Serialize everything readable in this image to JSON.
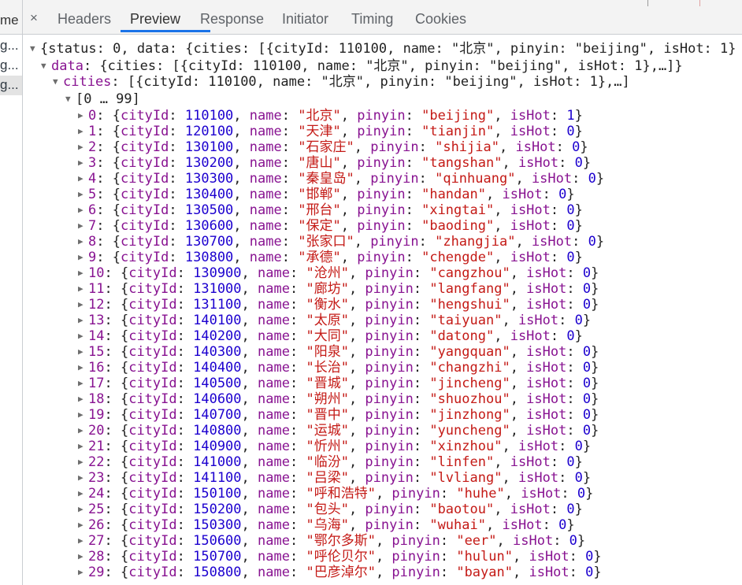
{
  "sidebar": {
    "header": "me",
    "rows": [
      "g...",
      "g...",
      "g..."
    ]
  },
  "tabs": {
    "close": "×",
    "items": [
      {
        "label": "Headers",
        "active": false
      },
      {
        "label": "Preview",
        "active": true
      },
      {
        "label": "Response",
        "active": false
      },
      {
        "label": "Initiator",
        "active": false
      },
      {
        "label": "Timing",
        "active": false
      },
      {
        "label": "Cookies",
        "active": false
      }
    ]
  },
  "preview": {
    "root_summary": "{status: 0, data: {cities: [{cityId: 110100, name: \"北京\", pinyin: \"beijing\", isHot: 1}",
    "data_summary": "{cities: [{cityId: 110100, name: \"北京\", pinyin: \"beijing\", isHot: 1},…]}",
    "cities_summary": "[{cityId: 110100, name: \"北京\", pinyin: \"beijing\", isHot: 1},…]",
    "range_label": "[0 … 99]",
    "keys": {
      "data": "data",
      "cities": "cities"
    },
    "field_names": {
      "id": "cityId",
      "name": "name",
      "pinyin": "pinyin",
      "hot": "isHot"
    },
    "cities": [
      {
        "index": "0",
        "cityId": "110100",
        "name": "\"北京\"",
        "pinyin": "\"beijing\"",
        "isHot": "1"
      },
      {
        "index": "1",
        "cityId": "120100",
        "name": "\"天津\"",
        "pinyin": "\"tianjin\"",
        "isHot": "0"
      },
      {
        "index": "2",
        "cityId": "130100",
        "name": "\"石家庄\"",
        "pinyin": "\"shijia\"",
        "isHot": "0"
      },
      {
        "index": "3",
        "cityId": "130200",
        "name": "\"唐山\"",
        "pinyin": "\"tangshan\"",
        "isHot": "0"
      },
      {
        "index": "4",
        "cityId": "130300",
        "name": "\"秦皇岛\"",
        "pinyin": "\"qinhuang\"",
        "isHot": "0"
      },
      {
        "index": "5",
        "cityId": "130400",
        "name": "\"邯郸\"",
        "pinyin": "\"handan\"",
        "isHot": "0"
      },
      {
        "index": "6",
        "cityId": "130500",
        "name": "\"邢台\"",
        "pinyin": "\"xingtai\"",
        "isHot": "0"
      },
      {
        "index": "7",
        "cityId": "130600",
        "name": "\"保定\"",
        "pinyin": "\"baoding\"",
        "isHot": "0"
      },
      {
        "index": "8",
        "cityId": "130700",
        "name": "\"张家口\"",
        "pinyin": "\"zhangjia\"",
        "isHot": "0"
      },
      {
        "index": "9",
        "cityId": "130800",
        "name": "\"承德\"",
        "pinyin": "\"chengde\"",
        "isHot": "0"
      },
      {
        "index": "10",
        "cityId": "130900",
        "name": "\"沧州\"",
        "pinyin": "\"cangzhou\"",
        "isHot": "0"
      },
      {
        "index": "11",
        "cityId": "131000",
        "name": "\"廊坊\"",
        "pinyin": "\"langfang\"",
        "isHot": "0"
      },
      {
        "index": "12",
        "cityId": "131100",
        "name": "\"衡水\"",
        "pinyin": "\"hengshui\"",
        "isHot": "0"
      },
      {
        "index": "13",
        "cityId": "140100",
        "name": "\"太原\"",
        "pinyin": "\"taiyuan\"",
        "isHot": "0"
      },
      {
        "index": "14",
        "cityId": "140200",
        "name": "\"大同\"",
        "pinyin": "\"datong\"",
        "isHot": "0"
      },
      {
        "index": "15",
        "cityId": "140300",
        "name": "\"阳泉\"",
        "pinyin": "\"yangquan\"",
        "isHot": "0"
      },
      {
        "index": "16",
        "cityId": "140400",
        "name": "\"长治\"",
        "pinyin": "\"changzhi\"",
        "isHot": "0"
      },
      {
        "index": "17",
        "cityId": "140500",
        "name": "\"晋城\"",
        "pinyin": "\"jincheng\"",
        "isHot": "0"
      },
      {
        "index": "18",
        "cityId": "140600",
        "name": "\"朔州\"",
        "pinyin": "\"shuozhou\"",
        "isHot": "0"
      },
      {
        "index": "19",
        "cityId": "140700",
        "name": "\"晋中\"",
        "pinyin": "\"jinzhong\"",
        "isHot": "0"
      },
      {
        "index": "20",
        "cityId": "140800",
        "name": "\"运城\"",
        "pinyin": "\"yuncheng\"",
        "isHot": "0"
      },
      {
        "index": "21",
        "cityId": "140900",
        "name": "\"忻州\"",
        "pinyin": "\"xinzhou\"",
        "isHot": "0"
      },
      {
        "index": "22",
        "cityId": "141000",
        "name": "\"临汾\"",
        "pinyin": "\"linfen\"",
        "isHot": "0"
      },
      {
        "index": "23",
        "cityId": "141100",
        "name": "\"吕梁\"",
        "pinyin": "\"lvliang\"",
        "isHot": "0"
      },
      {
        "index": "24",
        "cityId": "150100",
        "name": "\"呼和浩特\"",
        "pinyin": "\"huhe\"",
        "isHot": "0"
      },
      {
        "index": "25",
        "cityId": "150200",
        "name": "\"包头\"",
        "pinyin": "\"baotou\"",
        "isHot": "0"
      },
      {
        "index": "26",
        "cityId": "150300",
        "name": "\"乌海\"",
        "pinyin": "\"wuhai\"",
        "isHot": "0"
      },
      {
        "index": "27",
        "cityId": "150600",
        "name": "\"鄂尔多斯\"",
        "pinyin": "\"eer\"",
        "isHot": "0"
      },
      {
        "index": "28",
        "cityId": "150700",
        "name": "\"呼伦贝尔\"",
        "pinyin": "\"hulun\"",
        "isHot": "0"
      },
      {
        "index": "29",
        "cityId": "150800",
        "name": "\"巴彦淖尔\"",
        "pinyin": "\"bayan\"",
        "isHot": "0"
      }
    ]
  }
}
